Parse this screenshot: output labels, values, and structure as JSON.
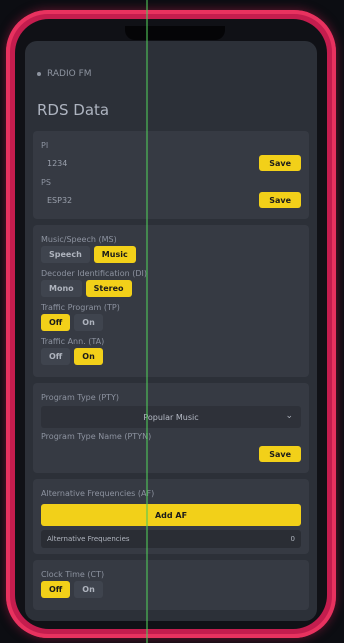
{
  "header": {
    "breadcrumb": "RADIO FM"
  },
  "page": {
    "title": "RDS Data"
  },
  "pi": {
    "label": "PI",
    "value": "1234",
    "save_label": "Save"
  },
  "ps": {
    "label": "PS",
    "value": "ESP32",
    "save_label": "Save"
  },
  "music_speech": {
    "label": "Music/Speech (MS)",
    "options": [
      "Speech",
      "Music"
    ],
    "selected": "Music"
  },
  "mono_stereo": {
    "label": "Decoder Identification (DI)",
    "options": [
      "Mono",
      "Stereo"
    ],
    "selected": "Stereo"
  },
  "traffic_program": {
    "label": "Traffic Program (TP)",
    "options": [
      "Off",
      "On"
    ],
    "selected": "Off"
  },
  "traffic_announcement": {
    "label": "Traffic Ann. (TA)",
    "options": [
      "Off",
      "On"
    ],
    "selected": "On"
  },
  "pty": {
    "label": "Program Type (PTY)",
    "selected": "Popular Music"
  },
  "pty_name": {
    "label": "Program Type Name (PTYN)",
    "save_label": "Save"
  },
  "af": {
    "label": "Alternative Frequencies (AF)",
    "add_label": "Add AF",
    "list_label": "Alternative Frequencies",
    "count": "0"
  },
  "ct": {
    "label": "Clock Time (CT)",
    "options": [
      "Off",
      "On"
    ],
    "selected": "Off"
  }
}
